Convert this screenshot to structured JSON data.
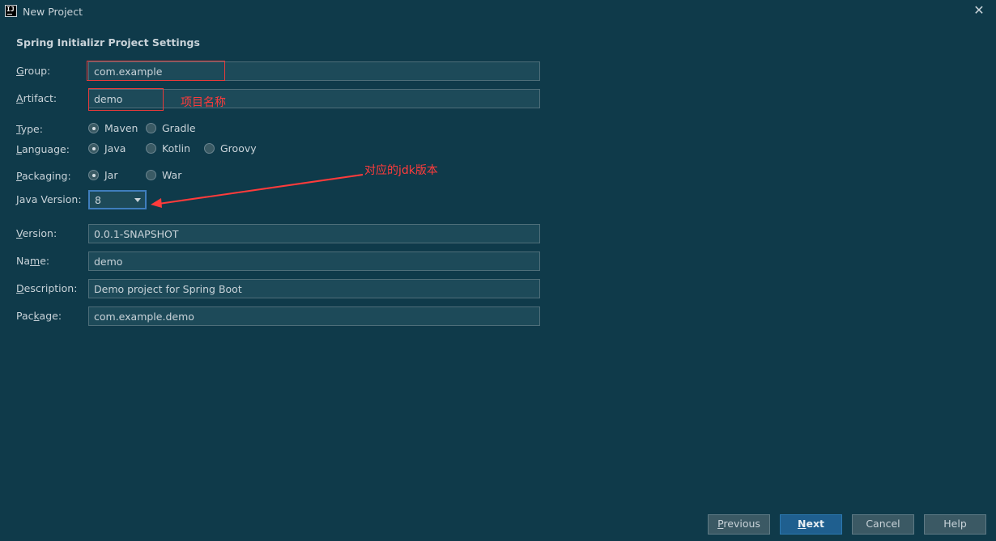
{
  "window": {
    "title": "New Project",
    "close_glyph": "✕"
  },
  "section_title": "Spring Initializr Project Settings",
  "form": {
    "group": {
      "label_u": "G",
      "label_rest": "roup:",
      "value": "com.example"
    },
    "artifact": {
      "label_u": "A",
      "label_rest": "rtifact:",
      "value": "demo"
    },
    "type": {
      "label_u": "T",
      "label_rest": "ype:",
      "options": [
        "Maven",
        "Gradle"
      ],
      "selected": "Maven"
    },
    "language": {
      "label_u": "L",
      "label_rest": "anguage:",
      "options": [
        "Java",
        "Kotlin",
        "Groovy"
      ],
      "selected": "Java"
    },
    "packaging": {
      "label_u": "P",
      "label_rest": "ackaging:",
      "options": [
        "Jar",
        "War"
      ],
      "selected": "Jar"
    },
    "java_version": {
      "label_u": "J",
      "label_rest": "ava Version:",
      "value": "8"
    },
    "version": {
      "label_u": "V",
      "label_rest": "ersion:",
      "value": "0.0.1-SNAPSHOT"
    },
    "name": {
      "label_pre": "Na",
      "label_u": "m",
      "label_rest": "e:",
      "value": "demo"
    },
    "description": {
      "label_u": "D",
      "label_rest": "escription:",
      "value": "Demo project for Spring Boot"
    },
    "package": {
      "label_pre": "Pac",
      "label_u": "k",
      "label_rest": "age:",
      "value": "com.example.demo"
    }
  },
  "annotations": {
    "project_name": "项目名称",
    "jdk_version": "对应的jdk版本",
    "color": "#ff3b3b"
  },
  "buttons": {
    "previous_u": "P",
    "previous_rest": "revious",
    "next_u": "N",
    "next_rest": "ext",
    "cancel": "Cancel",
    "help": "Help"
  },
  "colors": {
    "background": "#0f3a4a",
    "field": "#1d4a59",
    "accent": "#3f7ebd"
  }
}
